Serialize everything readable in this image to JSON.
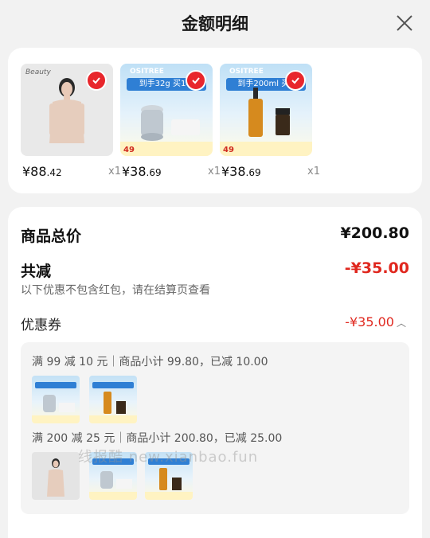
{
  "header": {
    "title": "金额明细",
    "close_icon": "close-icon"
  },
  "products": [
    {
      "price_main": "¥88",
      "price_decimal": ".42",
      "qty": "x1",
      "kind": "model",
      "thumb_text": "Beauty"
    },
    {
      "price_main": "¥38",
      "price_decimal": ".69",
      "qty": "x1",
      "kind": "promo",
      "thumb_text": "OSITREE",
      "banner": "到手32g 买1享",
      "chip": "49"
    },
    {
      "price_main": "¥38",
      "price_decimal": ".69",
      "qty": "x1",
      "kind": "promo",
      "thumb_text": "OSITREE",
      "banner": "到手200ml 买1",
      "chip": "49"
    }
  ],
  "summary": {
    "total_label": "商品总价",
    "total_value": "¥200.80",
    "discount_label": "共减",
    "discount_value": "-¥35.00",
    "note": "以下优惠不包含红包，请在结算页查看",
    "coupon_label": "优惠券",
    "coupon_value": "-¥35.00"
  },
  "coupons": [
    {
      "rule": "满 99 减 10 元｜商品小计 99.80，已减 10.00"
    },
    {
      "rule": "满 200 减 25 元｜商品小计 200.80，已减 25.00"
    }
  ],
  "watermark": "线报酷 new.xianbao.fun",
  "colors": {
    "accent_red": "#e0281f",
    "check_red": "#e8262c"
  }
}
